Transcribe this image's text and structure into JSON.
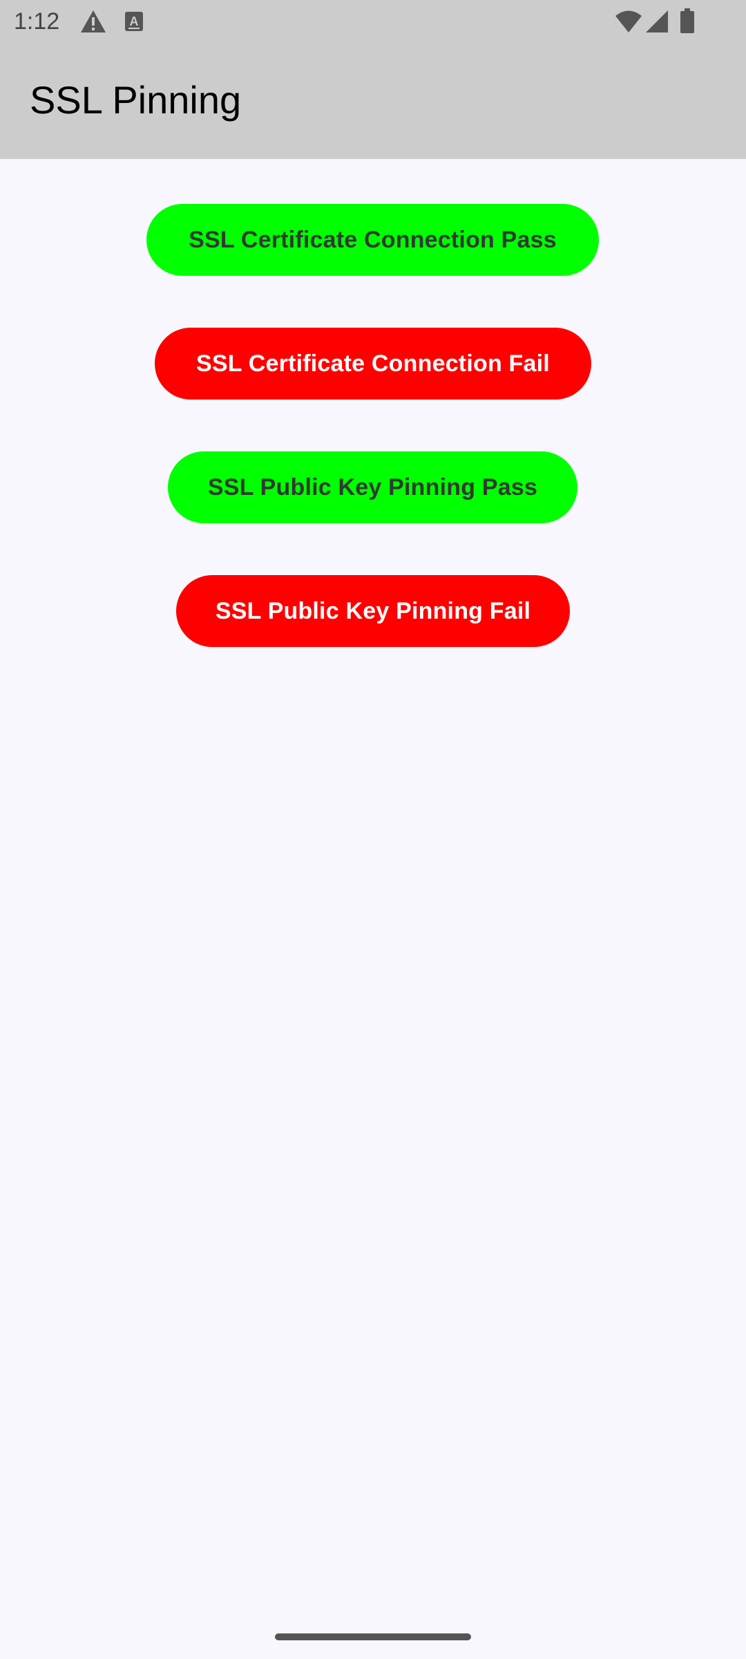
{
  "status_bar": {
    "time": "1:12",
    "icons": [
      "warning-icon",
      "font-a-icon",
      "wifi-icon",
      "signal-icon",
      "battery-icon"
    ]
  },
  "app_bar": {
    "title": "SSL Pinning"
  },
  "buttons": [
    {
      "label": "SSL Certificate Connection Pass",
      "color": "#00ff00",
      "text_color": "#2f3a2f"
    },
    {
      "label": "SSL Certificate Connection Fail",
      "color": "#ff0000",
      "text_color": "#ffffff"
    },
    {
      "label": "SSL Public Key Pinning Pass",
      "color": "#00ff00",
      "text_color": "#2f3a2f"
    },
    {
      "label": "SSL Public Key Pinning Fail",
      "color": "#ff0000",
      "text_color": "#ffffff"
    }
  ],
  "colors": {
    "bar_background": "#cccccc",
    "page_background": "#f8f7fd"
  }
}
